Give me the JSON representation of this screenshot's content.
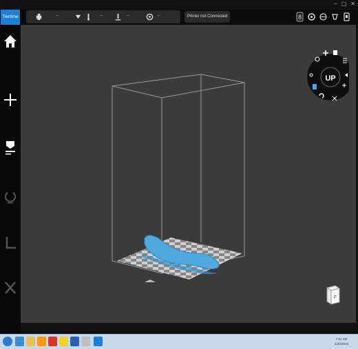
{
  "brand": {
    "label": "Tiertime"
  },
  "window_controls": [
    "–",
    "▢",
    "✕"
  ],
  "status_strip": {
    "values": [
      "–",
      "–",
      "–",
      "–",
      "–"
    ]
  },
  "printer": {
    "status_text": "Printer not Connected"
  },
  "top_right_icons": [
    "initialize-icon",
    "settings-icon",
    "calibrate-icon",
    "maintenance-icon",
    "printer-device-icon"
  ],
  "sidebar": {
    "items": [
      {
        "name": "home-button"
      },
      {
        "name": "add-model-button"
      },
      {
        "name": "print-button"
      },
      {
        "name": "rotate-button"
      },
      {
        "name": "ruler-button"
      },
      {
        "name": "tools-button"
      }
    ]
  },
  "radial_menu": {
    "center_label": "UP"
  },
  "view_cube": {
    "face_label": "F"
  },
  "taskbar": {
    "clock_time": "7:51 AM",
    "clock_date": "4/20/2019"
  },
  "colors": {
    "brand": "#1e7fd6",
    "viewport_bg": "#3b3b3b",
    "model": "#4fa9e0"
  }
}
